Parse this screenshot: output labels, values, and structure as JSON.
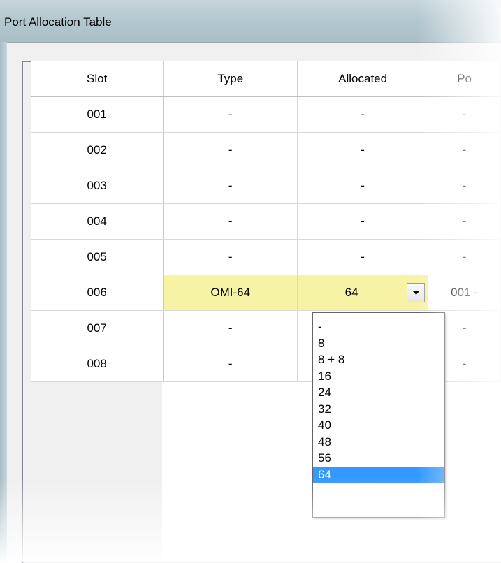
{
  "window": {
    "title": "Port Allocation Table"
  },
  "table": {
    "headers": [
      "Slot",
      "Type",
      "Allocated",
      "Po"
    ],
    "rows": [
      {
        "slot": "001",
        "type": "-",
        "allocated": "-",
        "ports": "-"
      },
      {
        "slot": "002",
        "type": "-",
        "allocated": "-",
        "ports": "-"
      },
      {
        "slot": "003",
        "type": "-",
        "allocated": "-",
        "ports": "-"
      },
      {
        "slot": "004",
        "type": "-",
        "allocated": "-",
        "ports": "-"
      },
      {
        "slot": "005",
        "type": "-",
        "allocated": "-",
        "ports": "-"
      },
      {
        "slot": "006",
        "type": "OMI-64",
        "allocated": "64",
        "ports": "001 -"
      },
      {
        "slot": "007",
        "type": "-",
        "allocated": "",
        "ports": "-"
      },
      {
        "slot": "008",
        "type": "-",
        "allocated": "",
        "ports": "-"
      }
    ]
  },
  "dropdown": {
    "options": [
      "-",
      "8",
      "8 + 8",
      "16",
      "24",
      "32",
      "40",
      "48",
      "56",
      "64"
    ],
    "selected": "64"
  },
  "colors": {
    "selected_cell": "#f7f3a5",
    "selected_option": "#3399ff"
  },
  "icons": {
    "combo_button": "chevron-down-icon"
  }
}
